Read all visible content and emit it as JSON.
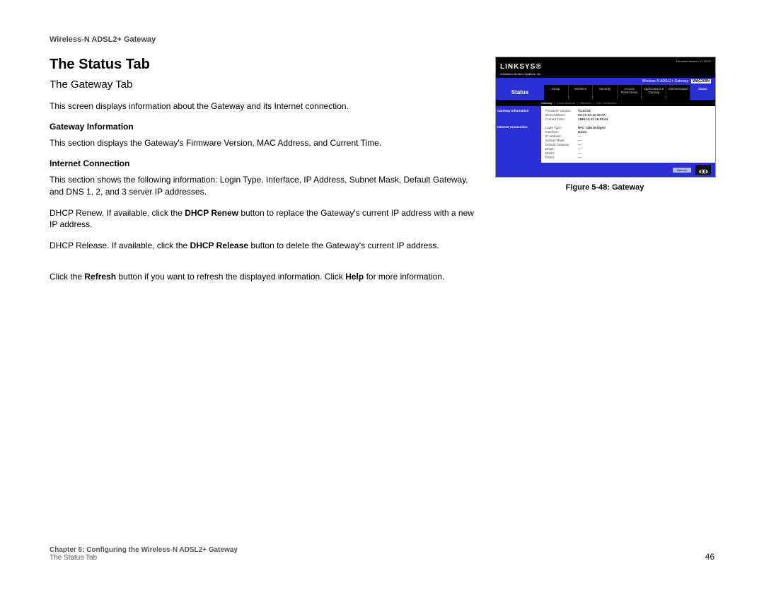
{
  "doc_header": "Wireless-N ADSL2+ Gateway",
  "section_title": "The Status Tab",
  "subsection_title": "The Gateway Tab",
  "intro": "This screen displays information about the Gateway and its Internet connection.",
  "gateway_info_heading": "Gateway Information",
  "gateway_info_text": "This section displays the Gateway's Firmware Version, MAC Address, and Current Time.",
  "internet_heading": "Internet Connection",
  "internet_text": "This section shows the following information: Login Type, Interface, IP Address, Subnet Mask, Default Gateway, and DNS 1, 2, and 3 server IP addresses.",
  "dhcp_renew_pre": "DHCP Renew. If available, click the ",
  "dhcp_renew_bold": "DHCP Renew",
  "dhcp_renew_post": " button to replace the Gateway's current IP address with a new IP address.",
  "dhcp_release_pre": "DHCP Release. If available, click the ",
  "dhcp_release_bold": "DHCP Release",
  "dhcp_release_post": " button to delete the Gateway's current IP address.",
  "refresh_pre": "Click the ",
  "refresh_bold": "Refresh",
  "refresh_mid": " button if you want to refresh the displayed information. Click ",
  "help_bold": "Help",
  "refresh_post": " for more information.",
  "figure_caption": "Figure 5-48: Gateway",
  "footer": {
    "chapter": "Chapter 5: Configuring the Wireless-N ADSL2+ Gateway",
    "sub": "The Status Tab",
    "page": "46"
  },
  "screenshot": {
    "brand": "LINKSYS®",
    "brand_sub": "A Division of Cisco Systems, Inc.",
    "firmware": "Firmware Version: V1.00.01",
    "product": "Wireless-N ADSL2+ Gateway",
    "model": "WAG300N",
    "active_main": "Status",
    "tabs": [
      "Setup",
      "Wireless",
      "Security",
      "Access Restrictions",
      "Applications & Gaming",
      "Administration",
      "Status"
    ],
    "subtabs": [
      "Gateway",
      "Local Network",
      "Wireless",
      "DSL Connection"
    ],
    "active_sub": "Gateway",
    "side_items": [
      "Gateway Information",
      "Internet Connection"
    ],
    "rows_top": [
      {
        "label": "Firmware Version:",
        "value": "V1.00.01"
      },
      {
        "label": "MAC Address:",
        "value": "00:C0:02:12:35:0A"
      },
      {
        "label": "Current Time:",
        "value": "1999-12-31 16:09:04"
      }
    ],
    "rows_bottom": [
      {
        "label": "Login Type:",
        "value": "RFC 1483 Bridged"
      },
      {
        "label": "Interface:",
        "value": "Down"
      },
      {
        "label": "IP Address:",
        "value": "---"
      },
      {
        "label": "Subnet Mask:",
        "value": "---"
      },
      {
        "label": "Default Gateway:",
        "value": "---"
      },
      {
        "label": "DNS1:",
        "value": "---"
      },
      {
        "label": "DNS2:",
        "value": "---"
      },
      {
        "label": "DNS3:",
        "value": "---"
      }
    ],
    "refresh_btn": "Refresh"
  }
}
